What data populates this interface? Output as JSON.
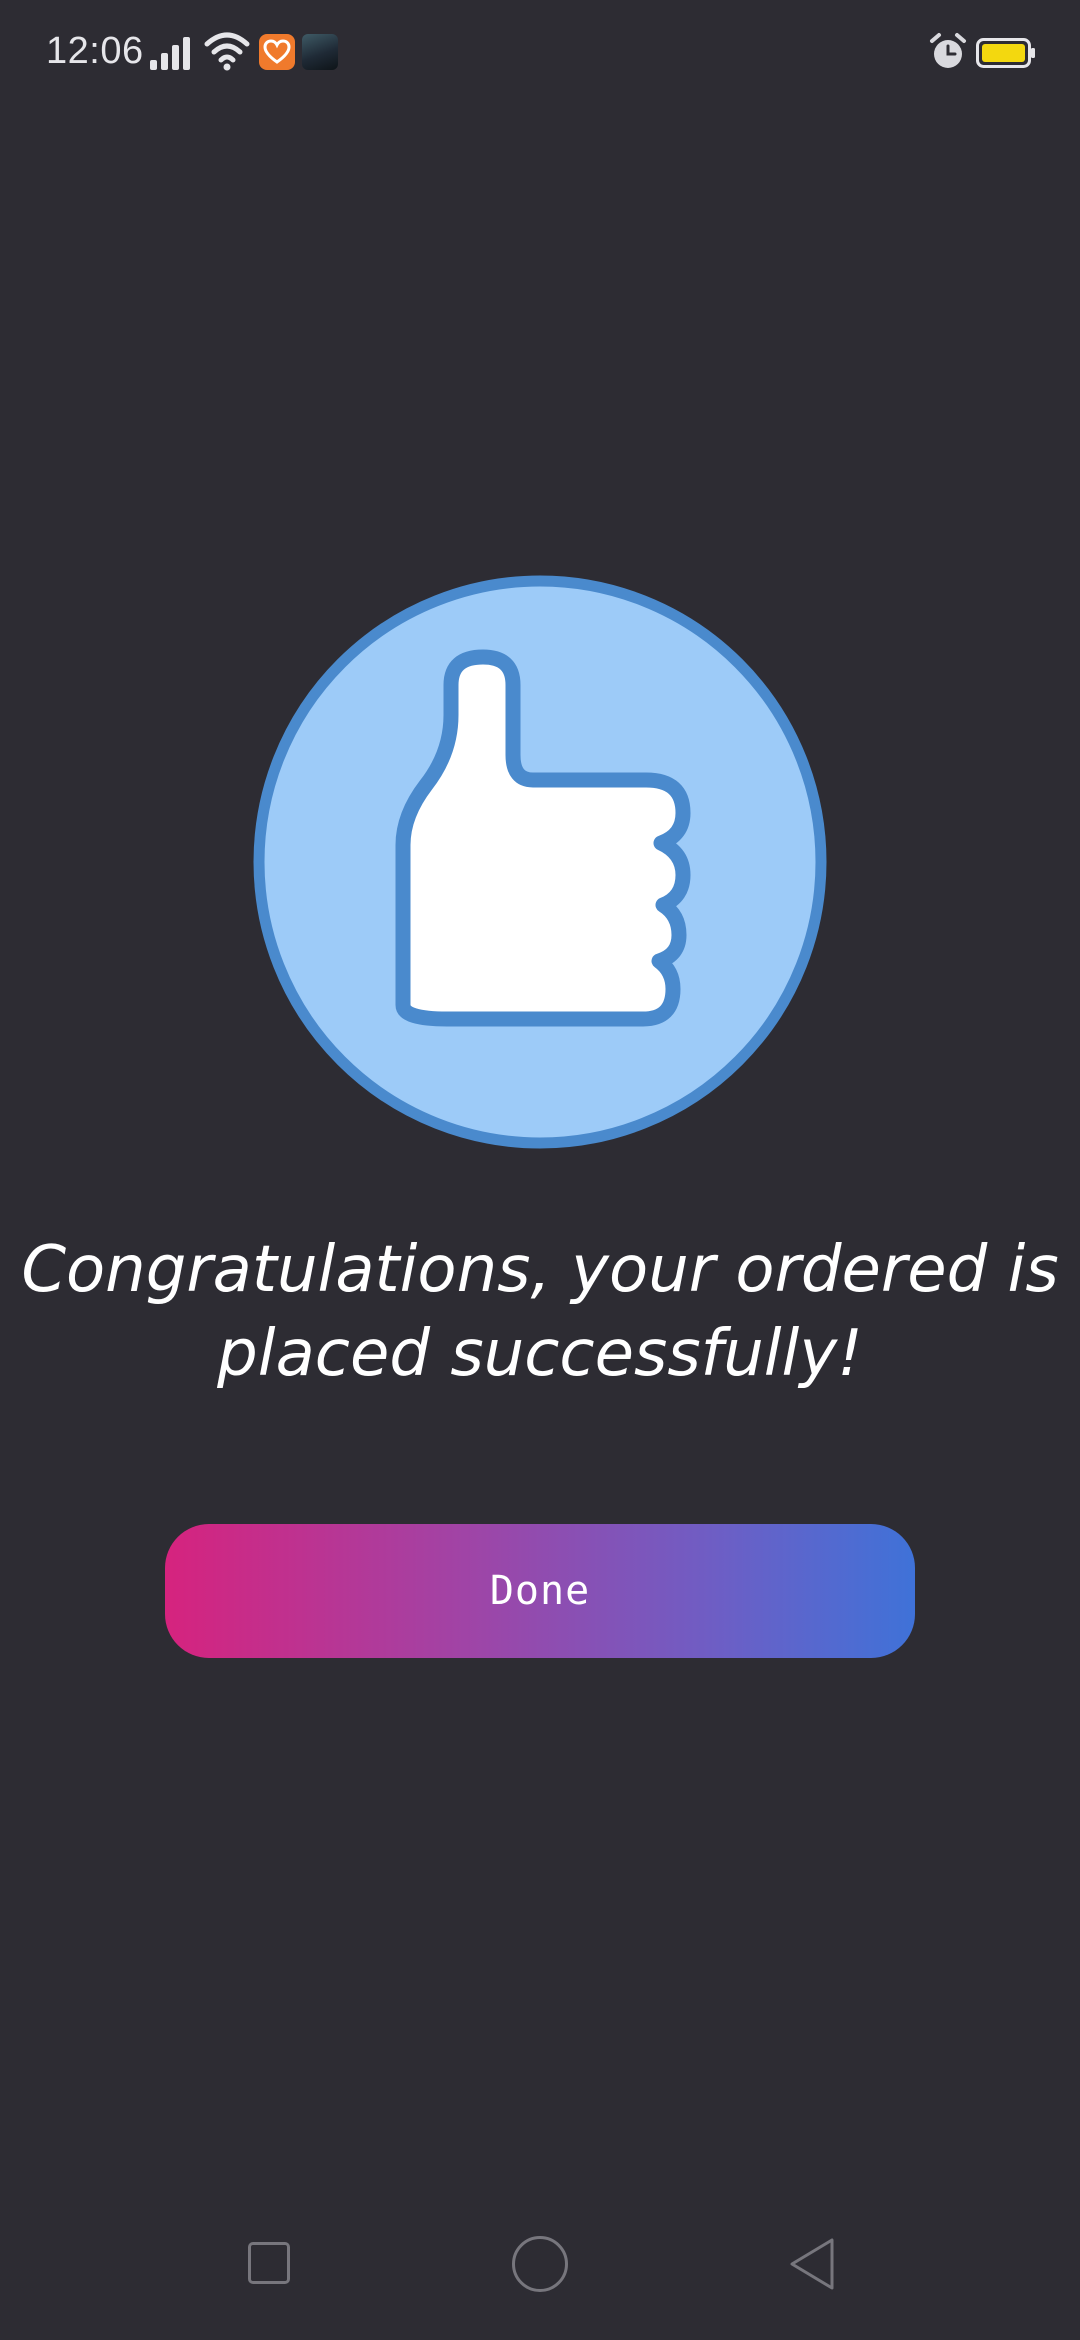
{
  "status_bar": {
    "time": "12:06",
    "icons": [
      "signal-icon",
      "wifi-icon",
      "health-app-icon",
      "photo-app-icon",
      "alarm-icon",
      "battery-icon"
    ],
    "battery_color": "#f3d80f"
  },
  "hero": {
    "icon": "thumbs-up-icon",
    "circle_fill": "#9dcbf8",
    "circle_stroke": "#4a8acd"
  },
  "message": "Congratulations, your ordered is placed successfully!",
  "done_button": {
    "label": "Done",
    "gradient_start": "#d6237e",
    "gradient_end": "#3f72d8"
  },
  "nav_bar": {
    "items": [
      "recent-apps-icon",
      "home-icon",
      "back-icon"
    ]
  },
  "colors": {
    "background": "#2d2c33"
  }
}
